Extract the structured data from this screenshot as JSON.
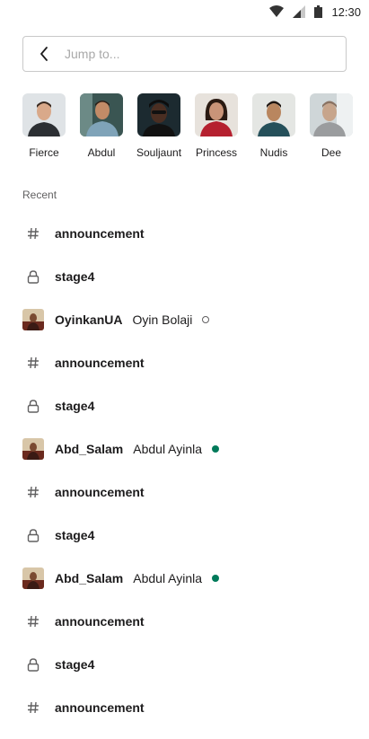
{
  "status_bar": {
    "time": "12:30",
    "icons": [
      "wifi-icon",
      "cellular-signal-icon",
      "battery-icon"
    ]
  },
  "search": {
    "placeholder": "Jump to..."
  },
  "people": [
    {
      "name": "Fierce"
    },
    {
      "name": "Abdul"
    },
    {
      "name": "Souljaunt"
    },
    {
      "name": "Princess"
    },
    {
      "name": "Nudis"
    },
    {
      "name": "Dee"
    }
  ],
  "recent": {
    "heading": "Recent",
    "items": [
      {
        "type": "channel",
        "icon": "hash-icon",
        "label": "announcement"
      },
      {
        "type": "private-channel",
        "icon": "lock-icon",
        "label": "stage4"
      },
      {
        "type": "dm",
        "icon": "avatar",
        "label": "OyinkanUA",
        "sub": "Oyin Bolaji",
        "presence": "away"
      },
      {
        "type": "channel",
        "icon": "hash-icon",
        "label": "announcement"
      },
      {
        "type": "private-channel",
        "icon": "lock-icon",
        "label": "stage4"
      },
      {
        "type": "dm",
        "icon": "avatar",
        "label": "Abd_Salam",
        "sub": "Abdul Ayinla",
        "presence": "active"
      },
      {
        "type": "channel",
        "icon": "hash-icon",
        "label": "announcement"
      },
      {
        "type": "private-channel",
        "icon": "lock-icon",
        "label": "stage4"
      },
      {
        "type": "dm",
        "icon": "avatar",
        "label": "Abd_Salam",
        "sub": "Abdul Ayinla",
        "presence": "active"
      },
      {
        "type": "channel",
        "icon": "hash-icon",
        "label": "announcement"
      },
      {
        "type": "private-channel",
        "icon": "lock-icon",
        "label": "stage4"
      },
      {
        "type": "channel",
        "icon": "hash-icon",
        "label": "announcement"
      }
    ]
  },
  "colors": {
    "active_presence": "#007a5a",
    "away_presence": "#616061",
    "text": "#1d1c1d",
    "muted": "#616061"
  }
}
